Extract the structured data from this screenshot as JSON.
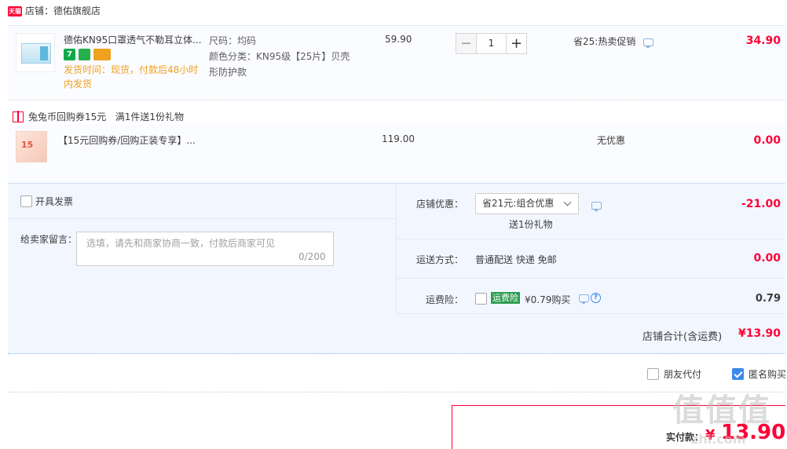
{
  "shop": {
    "badge": "天猫",
    "name_label": "店铺：德佑旗舰店"
  },
  "item1": {
    "title": "德佑KN95口罩透气不勒耳立体...",
    "tags": {
      "t1": "7",
      "t2": "",
      "t3": ""
    },
    "ship_time": "发货时间：现货，付款后48小时内发货",
    "attr_size": "尺码：均码",
    "attr_color": "颜色分类：KN95级【25片】贝壳形防护款",
    "price": "59.90",
    "quantity": "1",
    "promo": "省25:热卖促销",
    "subtotal": "34.90"
  },
  "gift": {
    "line": "兔兔币回购券15元   满1件送1份礼物",
    "thumb_text": "15",
    "title": "【15元回购券/回购正装专享】...",
    "price": "119.00",
    "promo": "无优惠",
    "subtotal": "0.00"
  },
  "options": {
    "invoice_label": "开具发票",
    "message_label": "给卖家留言：",
    "message_placeholder": "选填，请先和商家协商一致，付款后商家可见",
    "message_count": "0/200",
    "shop_discount_label": "店铺优惠：",
    "shop_discount_select": "省21元:组合优惠",
    "gift_note": "送1份礼物",
    "shop_discount_value": "-21.00",
    "shipping_label": "运送方式：",
    "shipping_value": "普通配送 快递 免邮",
    "shipping_fee": "0.00",
    "insurance_label": "运费险：",
    "insurance_tag": "运费险",
    "insurance_price": "¥0.79购买",
    "insurance_value": "0.79",
    "total_label": "店铺合计(含运费)",
    "total_value": "¥13.90"
  },
  "footer": {
    "friend_pay": "朋友代付",
    "anonymous": "匿名购买",
    "pay_label": "实付款：",
    "pay_yen": "¥",
    "pay_value": "13.90",
    "watermark": "值值值",
    "watermark_url": "zhi.com"
  },
  "colors": {
    "accent": "#ff0036",
    "ship_time": "#f0a11e",
    "checked": "#3b8aeb",
    "insurance": "#2a9d4e"
  }
}
